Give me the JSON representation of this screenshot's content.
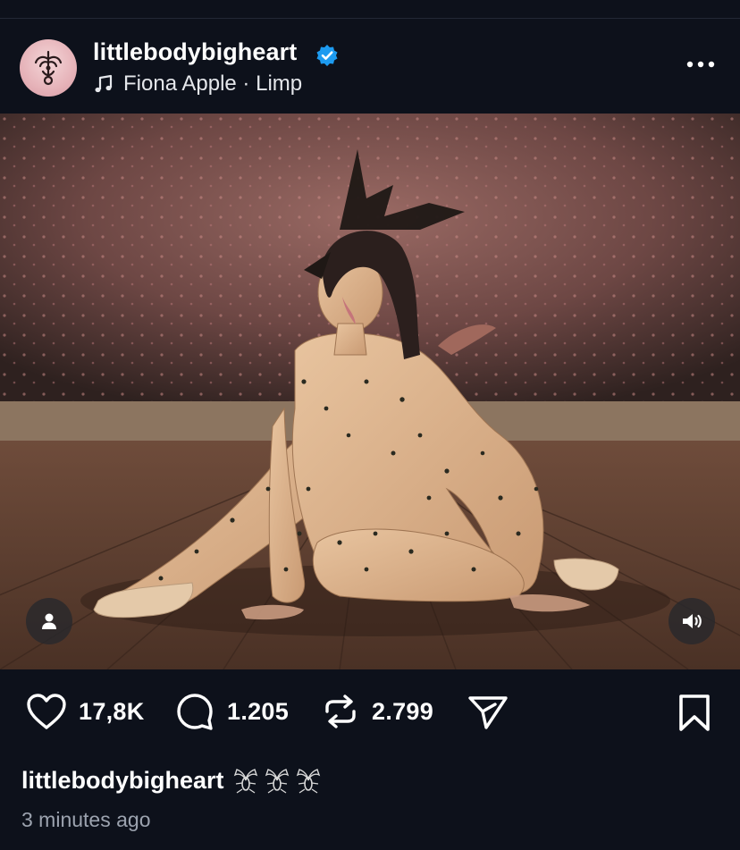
{
  "post": {
    "username": "littlebodybigheart",
    "verified": true,
    "music": {
      "artist": "Fiona Apple",
      "separator": " · ",
      "song": "Limp"
    },
    "icons": {
      "verified": "verified-badge-icon",
      "music": "music-note-icon",
      "more": "more-options-icon",
      "user_tag": "person-tag-icon",
      "mute": "speaker-icon"
    },
    "media": {
      "type": "photo",
      "has_user_tags": true
    },
    "actions": {
      "likes": "17,8K",
      "comments": "1.205",
      "reposts": "2.799",
      "icons": [
        "heart-icon",
        "comment-icon",
        "repost-icon",
        "share-icon",
        "bookmark-icon"
      ]
    },
    "caption": {
      "username": "littlebodybigheart",
      "emoji_count": 3,
      "emoji_icon": "fly-bug-icon"
    },
    "timestamp": "3 minutes ago"
  },
  "colors": {
    "background": "#0d111b",
    "text": "#ffffff",
    "secondary_text": "#9ca3af",
    "verified_blue": "#1d9bf0"
  }
}
